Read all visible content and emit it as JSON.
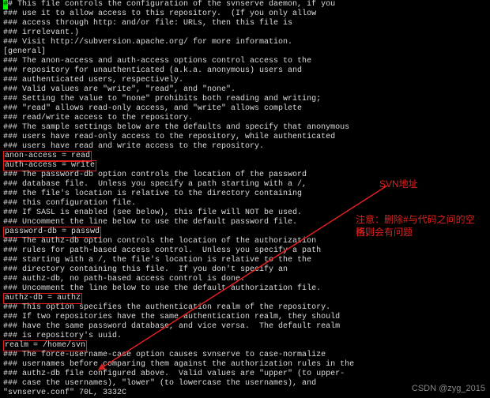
{
  "lines": [
    "## This file controls the configuration of the svnserve daemon, if you",
    "### use it to allow access to this repository.  (If you only allow",
    "### access through http: and/or file: URLs, then this file is",
    "### irrelevant.)",
    "",
    "### Visit http://subversion.apache.org/ for more information.",
    "",
    "[general]",
    "### The anon-access and auth-access options control access to the",
    "### repository for unauthenticated (a.k.a. anonymous) users and",
    "### authenticated users, respectively.",
    "### Valid values are \"write\", \"read\", and \"none\".",
    "### Setting the value to \"none\" prohibits both reading and writing;",
    "### \"read\" allows read-only access, and \"write\" allows complete",
    "### read/write access to the repository.",
    "### The sample settings below are the defaults and specify that anonymous",
    "### users have read-only access to the repository, while authenticated",
    "### users have read and write access to the repository.",
    "anon-access = read",
    "auth-access = write",
    "### The password-db option controls the location of the password",
    "### database file.  Unless you specify a path starting with a /,",
    "### the file's location is relative to the directory containing",
    "### this configuration file.",
    "### If SASL is enabled (see below), this file will NOT be used.",
    "### Uncomment the line below to use the default password file.",
    "password-db = passwd",
    "### The authz-db option controls the location of the authorization",
    "### rules for path-based access control.  Unless you specify a path",
    "### starting with a /, the file's location is relative to the the",
    "### directory containing this file.  If you don't specify an",
    "### authz-db, no path-based access control is done.",
    "### Uncomment the line below to use the default authorization file.",
    "authz-db = authz",
    "### This option specifies the authentication realm of the repository.",
    "### If two repositories have the same authentication realm, they should",
    "### have the same password database, and vice versa.  The default realm",
    "### is repository's uuid.",
    "realm = /home/svn",
    "### The force-username-case option causes svnserve to case-normalize",
    "### usernames before comparing them against the authorization rules in the",
    "### authz-db file configured above.  Valid values are \"upper\" (to upper-",
    "### case the usernames), \"lower\" (to lowercase the usernames), and"
  ],
  "highlight_indices": [
    18,
    19,
    26,
    33,
    38
  ],
  "status_line": "\"svnserve.conf\" 70L, 3332C",
  "annotations": {
    "svn_addr": "SVN地址",
    "note_l1": "注意：删除#与代码之间的空格，",
    "note_l2": "否则会有问题"
  },
  "watermark": "CSDN @zyg_2015"
}
